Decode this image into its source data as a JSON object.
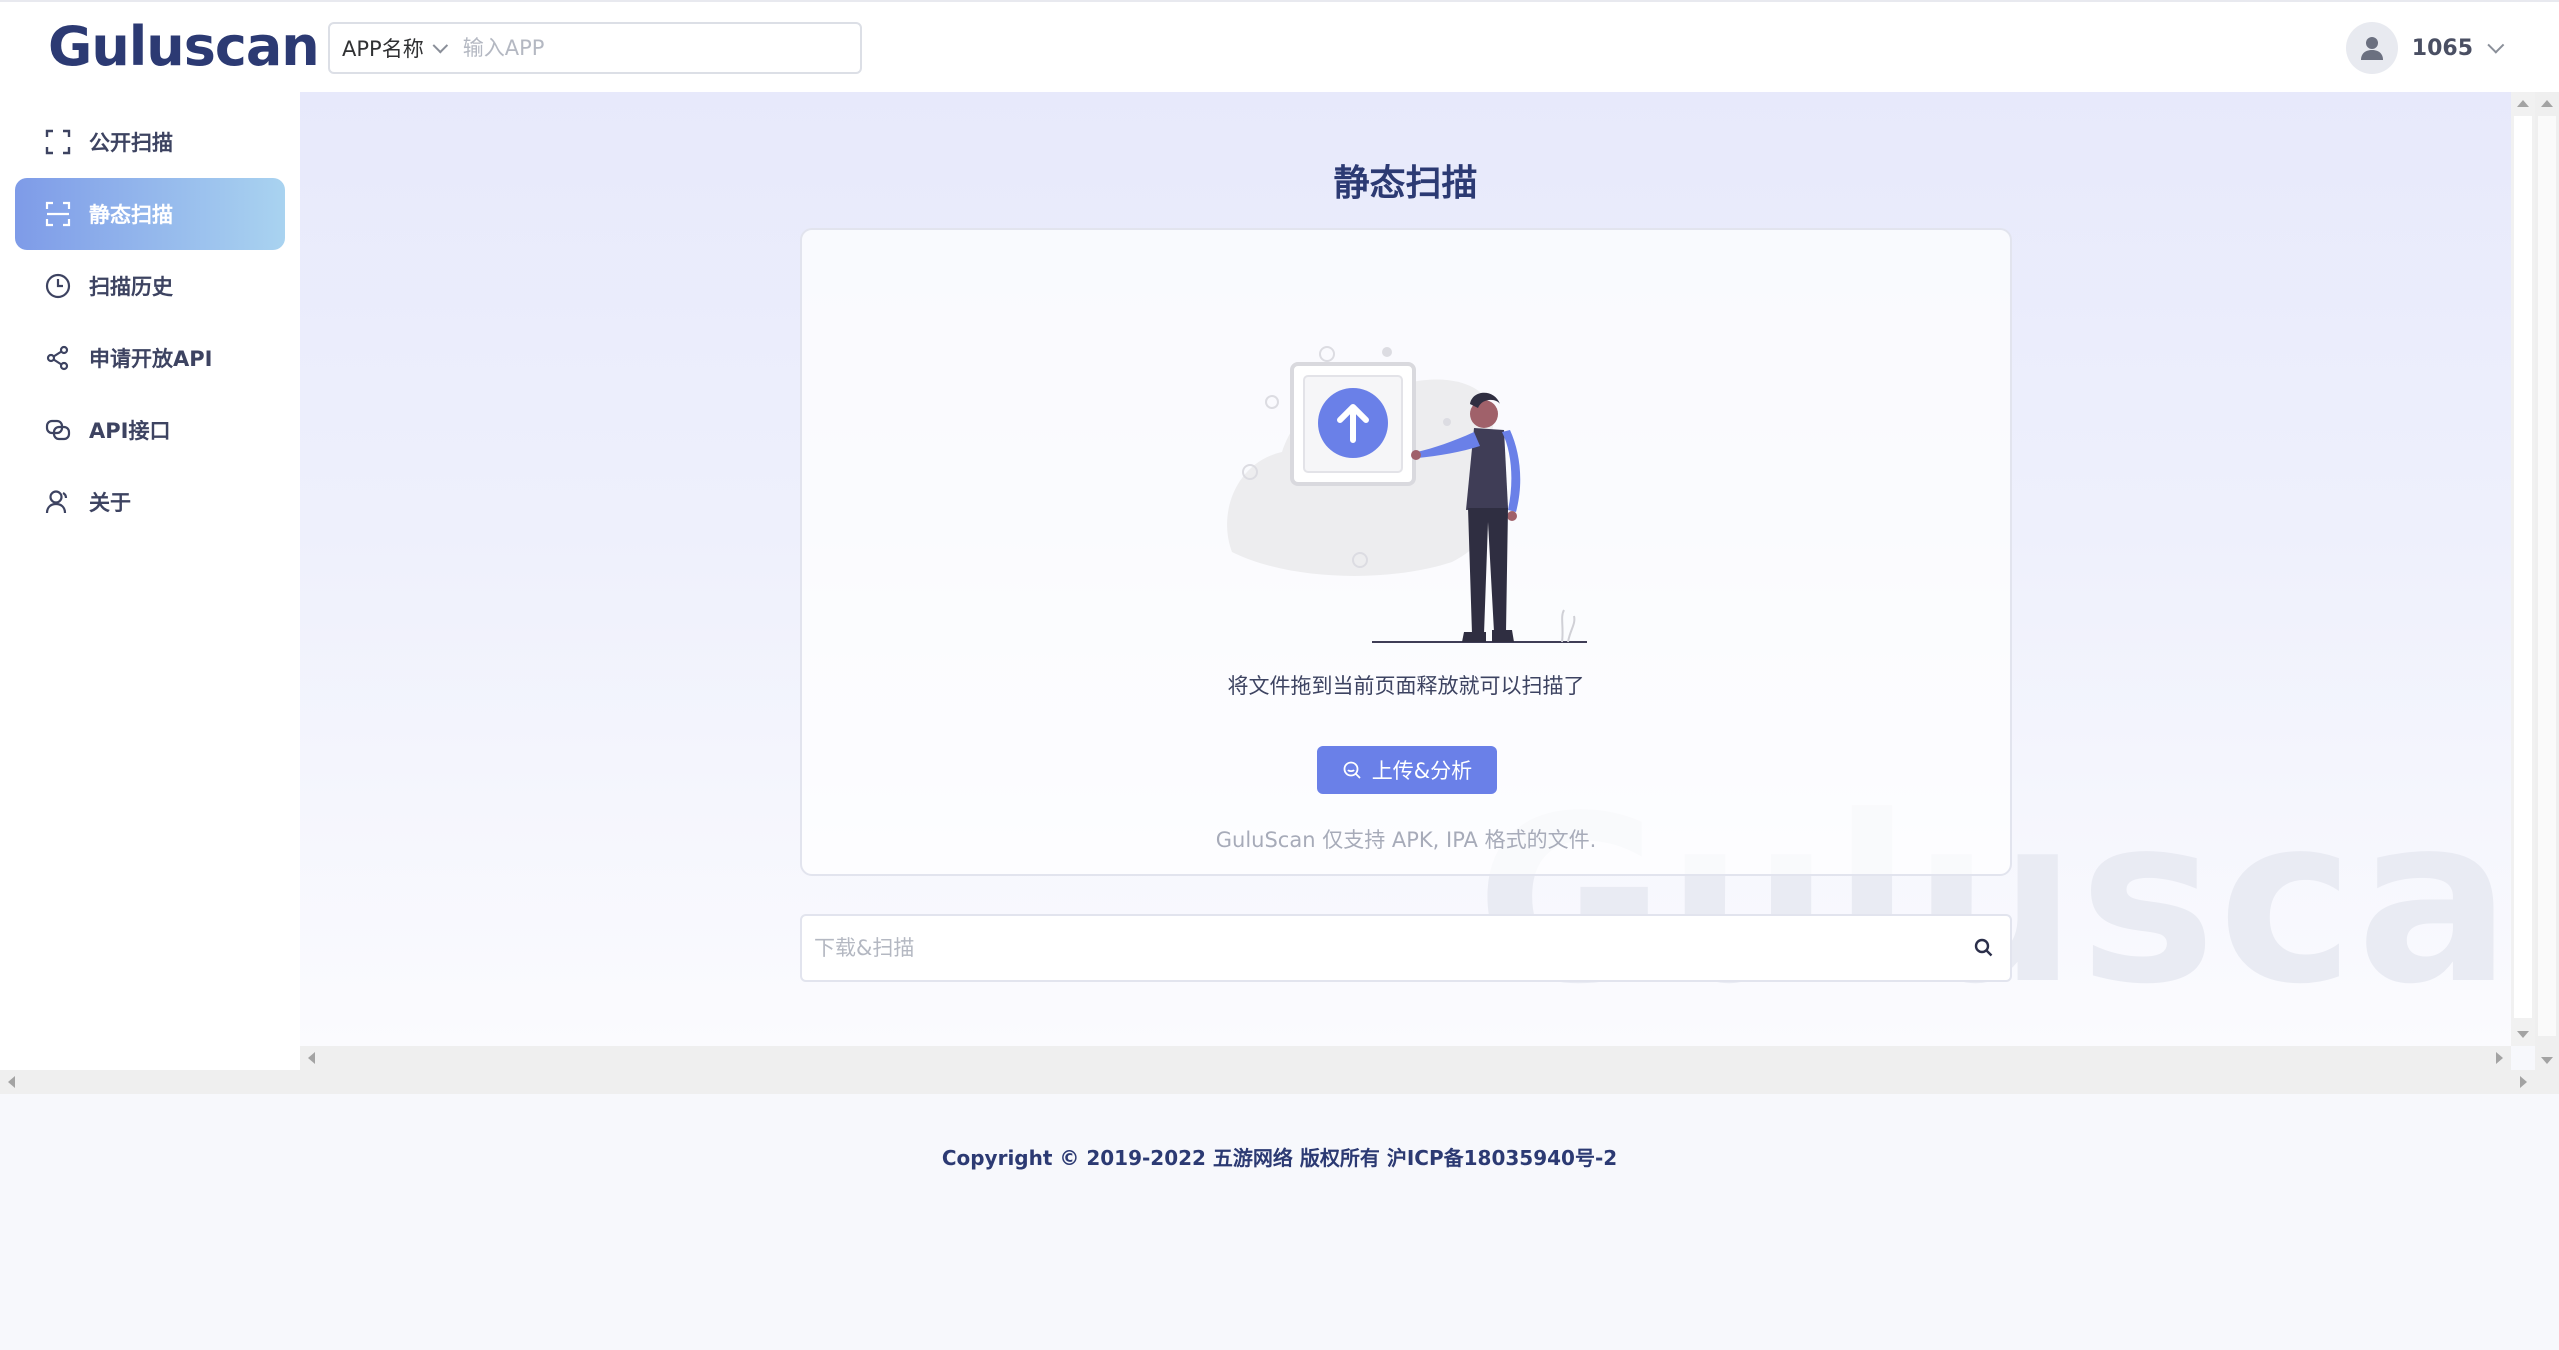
{
  "app": {
    "logo": "Guluscan"
  },
  "header": {
    "search_select_label": "APP名称",
    "search_placeholder": "输入APP",
    "user_name": "1065"
  },
  "sidebar": {
    "items": [
      {
        "label": "公开扫描",
        "icon": "scan-frame-icon",
        "active": false
      },
      {
        "label": "静态扫描",
        "icon": "scan-line-icon",
        "active": true
      },
      {
        "label": "扫描历史",
        "icon": "clock-icon",
        "active": false
      },
      {
        "label": "申请开放API",
        "icon": "share-icon",
        "active": false
      },
      {
        "label": "API接口",
        "icon": "link-icon",
        "active": false
      },
      {
        "label": "关于",
        "icon": "user-icon",
        "active": false
      }
    ]
  },
  "main": {
    "title": "静态扫描",
    "drop_hint": "将文件拖到当前页面释放就可以扫描了",
    "upload_button": "上传&分析",
    "support_note": "GuluScan 仅支持 APK, IPA 格式的文件.",
    "download_placeholder": "下载&扫描",
    "watermark": "Guluscan"
  },
  "footer": {
    "copyright": "Copyright © 2019-2022 五游网络 版权所有 沪ICP备18035940号-2"
  },
  "colors": {
    "brand": "#2c3a73",
    "accent": "#6a80e8",
    "active_nav_start": "#7e9be8",
    "active_nav_end": "#a9d3f0"
  }
}
